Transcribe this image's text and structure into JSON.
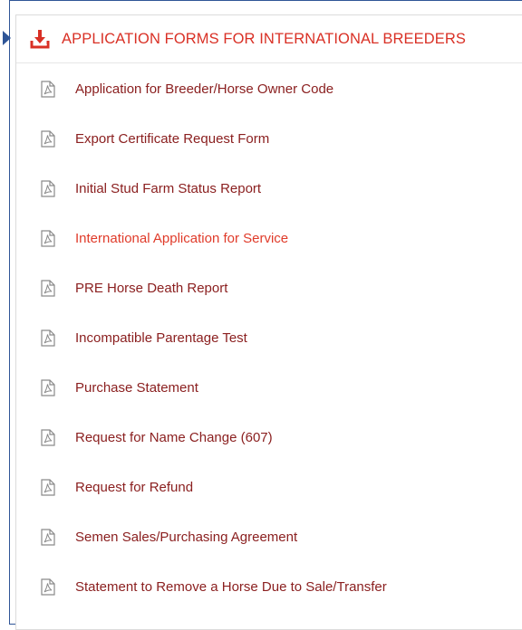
{
  "panel": {
    "title": "APPLICATION FORMS FOR INTERNATIONAL BREEDERS",
    "header_icon": "download-icon"
  },
  "colors": {
    "title": "#d93025",
    "link": "#8b2020",
    "active_link": "#e03b2a",
    "frame": "#2f5597"
  },
  "items": [
    {
      "label": "Application for Breeder/Horse Owner Code",
      "icon": "pdf-icon"
    },
    {
      "label": "Export Certificate Request Form",
      "icon": "pdf-icon"
    },
    {
      "label": "Initial Stud Farm Status Report",
      "icon": "pdf-icon"
    },
    {
      "label": "International Application for Service",
      "icon": "pdf-icon",
      "active": true
    },
    {
      "label": "PRE Horse Death Report",
      "icon": "pdf-icon"
    },
    {
      "label": "Incompatible Parentage Test",
      "icon": "pdf-icon"
    },
    {
      "label": "Purchase Statement",
      "icon": "pdf-icon"
    },
    {
      "label": "Request for Name Change (607)",
      "icon": "pdf-icon"
    },
    {
      "label": "Request for Refund",
      "icon": "pdf-icon"
    },
    {
      "label": "Semen Sales/Purchasing Agreement",
      "icon": "pdf-icon"
    },
    {
      "label": "Statement to Remove a Horse Due to Sale/Transfer",
      "icon": "pdf-icon"
    }
  ]
}
